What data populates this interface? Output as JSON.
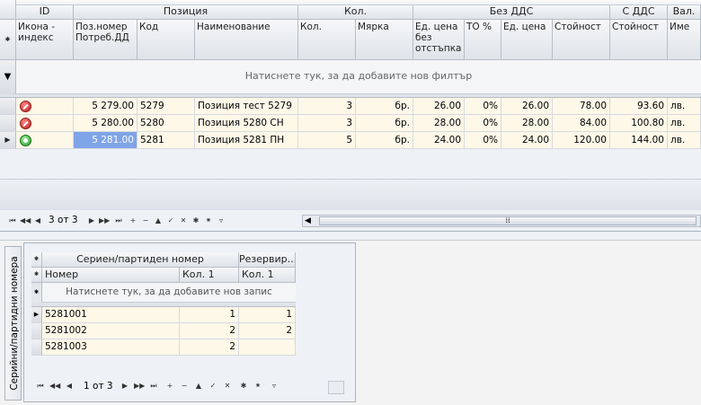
{
  "main_grid": {
    "groups": {
      "id": "ID",
      "position": "Позиция",
      "qty": "Кол.",
      "no_vat": "Без ДДС",
      "with_vat": "С ДДС",
      "currency": "Вал."
    },
    "columns": [
      "Икона - индекс",
      "Поз.номер Потреб.ДД",
      "Код",
      "Наименование",
      "Кол.",
      "Мярка",
      "Ед. цена без отстъпка",
      "ТО %",
      "Ед. цена",
      "Стойност",
      "Стойност",
      "Име"
    ],
    "filter_hint": "Натиснете тук, за да добавите нов филтър",
    "rows": [
      {
        "icon": "red",
        "pos": "5 279.00",
        "code": "5279",
        "name": "Позиция тест 5279",
        "qty": "3",
        "unit": "бр.",
        "price_nd": "26.00",
        "to": "0%",
        "price": "26.00",
        "value": "78.00",
        "value_vat": "93.60",
        "cur": "лв."
      },
      {
        "icon": "red",
        "pos": "5 280.00",
        "code": "5280",
        "name": "Позиция 5280 СН",
        "qty": "3",
        "unit": "бр.",
        "price_nd": "28.00",
        "to": "0%",
        "price": "28.00",
        "value": "84.00",
        "value_vat": "100.80",
        "cur": "лв."
      },
      {
        "icon": "green",
        "pos": "5 281.00",
        "code": "5281",
        "name": "Позиция 5281 ПН",
        "qty": "5",
        "unit": "бр.",
        "price_nd": "24.00",
        "to": "0%",
        "price": "24.00",
        "value": "120.00",
        "value_vat": "144.00",
        "cur": "лв."
      }
    ],
    "nav_text": "3 от 3",
    "scroll_grip": "⁞⁞"
  },
  "side_tab": {
    "label": "Серийни/партидни номера"
  },
  "serial_grid": {
    "groups": {
      "serial": "Сериен/партиден номер",
      "reserved": "Резервир..."
    },
    "columns": [
      "Номер",
      "Кол. 1",
      "Кол. 1"
    ],
    "add_hint": "Натиснете тук, за да добавите нов запис",
    "rows": [
      {
        "num": "5281001",
        "q1": "1",
        "q2": "1"
      },
      {
        "num": "5281002",
        "q1": "2",
        "q2": "2"
      },
      {
        "num": "5281003",
        "q1": "2",
        "q2": ""
      }
    ],
    "nav_text": "1 от 3"
  },
  "colors": {
    "selected_cell": "#7fa4e8",
    "row_bg": "#fdf8e8"
  }
}
